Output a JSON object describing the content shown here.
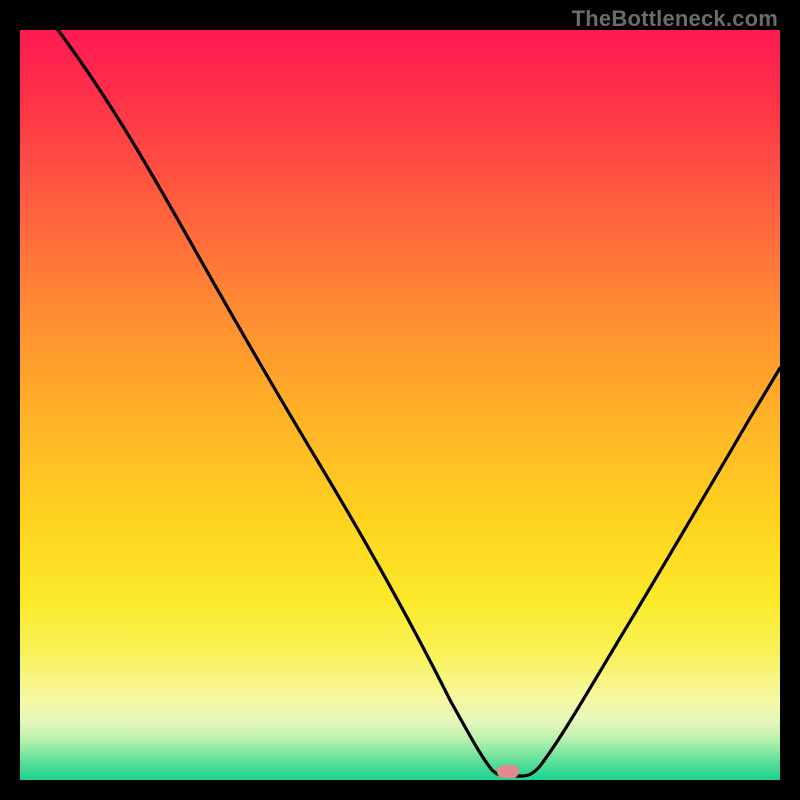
{
  "watermark": "TheBottleneck.com",
  "chart_data": {
    "type": "line",
    "title": "",
    "xlabel": "",
    "ylabel": "",
    "xlim": [
      0,
      100
    ],
    "ylim": [
      0,
      100
    ],
    "x": [
      5,
      15,
      25,
      35,
      45,
      52,
      58,
      62,
      64,
      66,
      70,
      78,
      86,
      94,
      100
    ],
    "values": [
      100,
      87,
      72,
      56,
      40,
      27,
      14,
      5,
      1,
      0.5,
      4,
      20,
      38,
      55,
      68
    ],
    "marker": {
      "x": 64,
      "y": 0.5,
      "color": "#e28b8f"
    },
    "gradient_stops": [
      {
        "pos": 0,
        "color": "#ff1a52"
      },
      {
        "pos": 22,
        "color": "#ff5a3f"
      },
      {
        "pos": 52,
        "color": "#ffb327"
      },
      {
        "pos": 76,
        "color": "#fce92a"
      },
      {
        "pos": 92,
        "color": "#e7f7ba"
      },
      {
        "pos": 100,
        "color": "#1cd290"
      }
    ]
  }
}
